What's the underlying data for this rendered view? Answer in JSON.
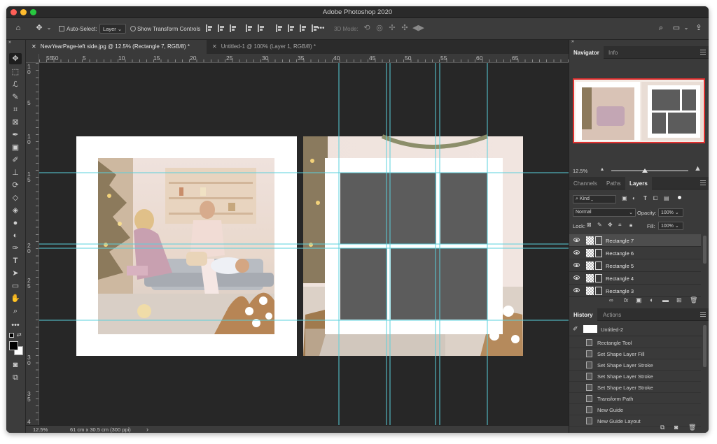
{
  "app": {
    "title": "Adobe Photoshop 2020",
    "traffic_lights": [
      "#fe5f57",
      "#febc2e",
      "#28c840"
    ]
  },
  "options_bar": {
    "auto_select_label": "Auto-Select:",
    "auto_select_value": "Layer",
    "show_transform_label": "Show Transform Controls",
    "three_d_mode_label": "3D Mode:",
    "more": "•••"
  },
  "tabs": [
    {
      "label": "NewYearPage-left side.jpg @ 12.5% (Rectangle 7, RGB/8) *",
      "active": true
    },
    {
      "label": "Untitled-1 @ 100% (Layer 1, RGB/8) *",
      "active": false
    }
  ],
  "rulers": {
    "top": [
      "55",
      "50",
      "5",
      "10",
      "15",
      "20",
      "25",
      "30",
      "35",
      "40",
      "45",
      "50",
      "55",
      "60",
      "65"
    ],
    "left": [
      "1",
      "0",
      "5",
      "1",
      "0",
      "1",
      "5",
      "2",
      "0",
      "2",
      "5",
      "3",
      "0",
      "3",
      "5",
      "4"
    ]
  },
  "status": {
    "zoom": "12.5%",
    "doc_info": "61 cm x 30.5 cm (300 ppi)",
    "arrow": "›"
  },
  "navigator": {
    "tabs": [
      "Navigator",
      "Info"
    ],
    "zoom": "12.5%"
  },
  "layers_panel": {
    "tabs": [
      "Channels",
      "Paths",
      "Layers"
    ],
    "kind_label": "Kind",
    "blend_mode": "Normal",
    "opacity_label": "Opacity:",
    "opacity_value": "100%",
    "lock_label": "Lock:",
    "fill_label": "Fill:",
    "fill_value": "100%",
    "layers": [
      {
        "name": "Rectangle 7",
        "selected": true
      },
      {
        "name": "Rectangle 6",
        "selected": false
      },
      {
        "name": "Rectangle 5",
        "selected": false
      },
      {
        "name": "Rectangle 4",
        "selected": false
      },
      {
        "name": "Rectangle 3",
        "selected": false
      }
    ],
    "fx_label": "fx"
  },
  "history_panel": {
    "tabs": [
      "History",
      "Actions"
    ],
    "snapshot": "Untitled-2",
    "states": [
      "Rectangle Tool",
      "Set Shape Layer Fill",
      "Set Shape Layer Stroke",
      "Set Shape Layer Stroke",
      "Set Shape Layer Stroke",
      "Transform Path",
      "New Guide",
      "New Guide Layout"
    ]
  },
  "colors": {
    "canvas_bg": "#272727",
    "guide": "#5ad0dc",
    "placeholder": "#5c5c5c",
    "photo_frame": "#ffffff"
  }
}
